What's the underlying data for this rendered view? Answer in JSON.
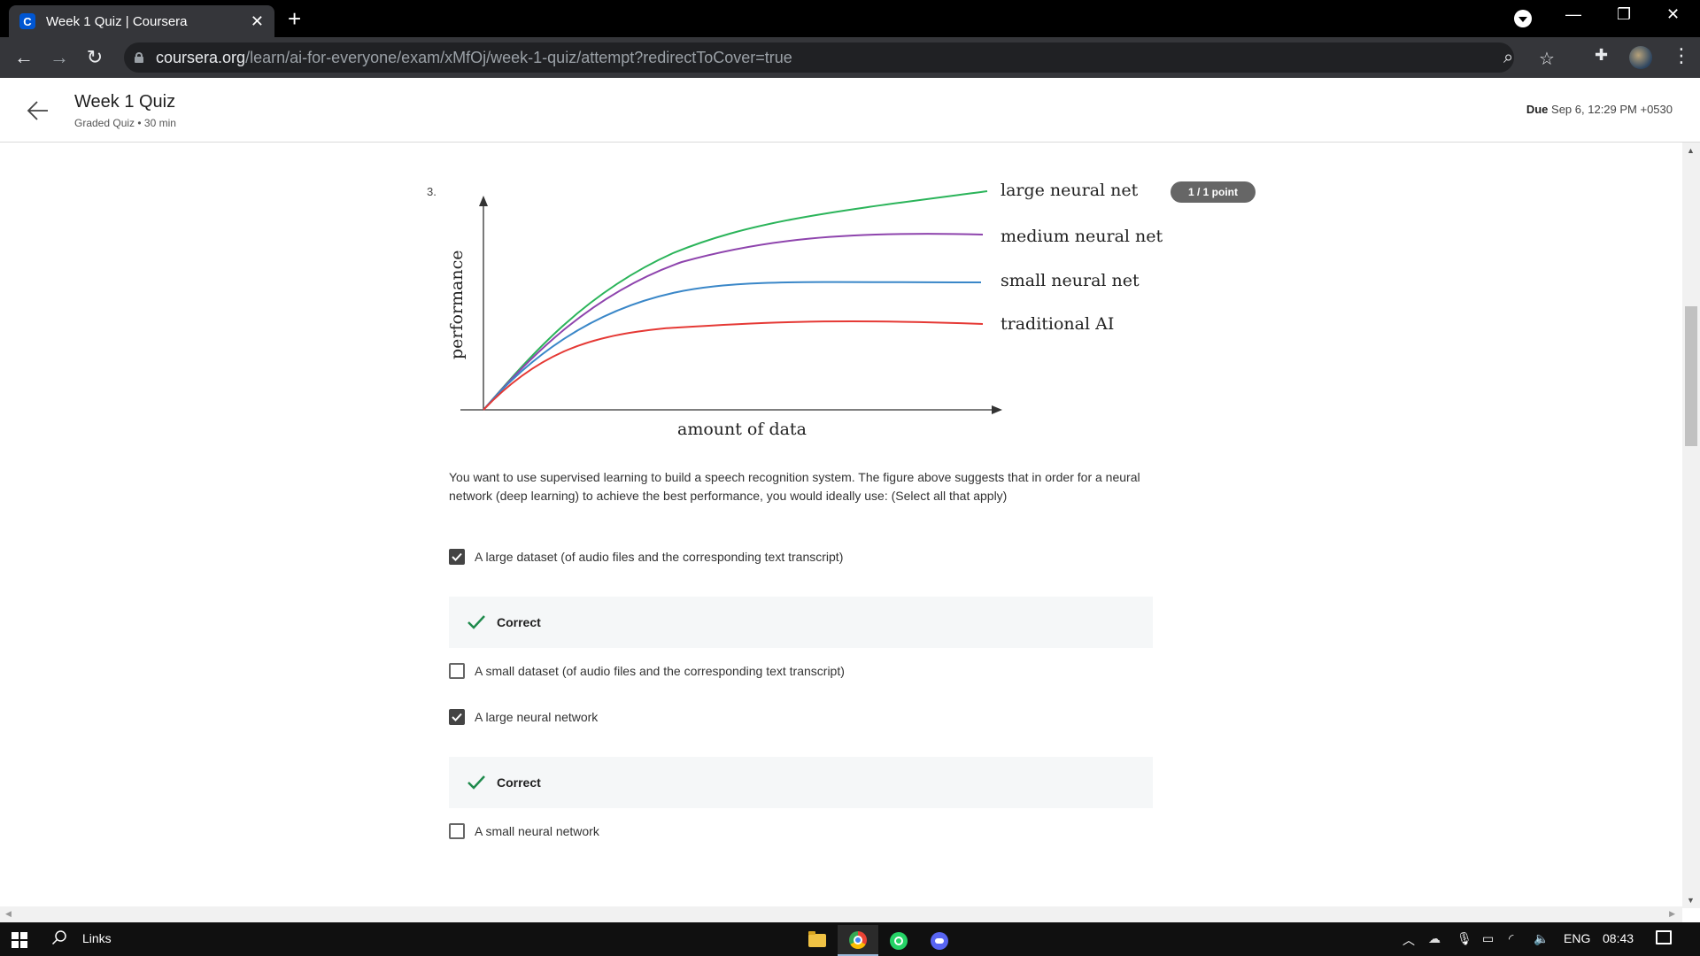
{
  "browser": {
    "tab_title": "Week 1 Quiz | Coursera",
    "tab_favicon": "C",
    "url_host": "coursera.org",
    "url_path": "/learn/ai-for-everyone/exam/xMfOj/week-1-quiz/attempt?redirectToCover=true"
  },
  "header": {
    "title": "Week 1 Quiz",
    "meta": "Graded Quiz • 30 min",
    "due_label": "Due",
    "due_value": "Sep 6, 12:29 PM +0530"
  },
  "question": {
    "number": "3.",
    "points": "1 / 1 point",
    "prompt": "You want to use supervised learning to build a speech recognition system. The figure above suggests that in order for a neural network (deep learning) to achieve the best performance, you would ideally use: (Select all that apply)",
    "options": [
      {
        "label": "A large dataset (of audio files and the corresponding text transcript)",
        "checked": true
      },
      {
        "label": "A small dataset (of audio files and the corresponding text transcript)",
        "checked": false
      },
      {
        "label": "A large neural network",
        "checked": true
      },
      {
        "label": "A small neural network",
        "checked": false
      }
    ],
    "feedback": [
      "Correct",
      "Correct"
    ]
  },
  "chart_data": {
    "type": "line",
    "xlabel": "amount of data",
    "ylabel": "performance",
    "series": [
      {
        "name": "large neural net",
        "color": "#2bb45a"
      },
      {
        "name": "medium neural net",
        "color": "#8e44ad"
      },
      {
        "name": "small neural net",
        "color": "#3a87c8"
      },
      {
        "name": "traditional AI",
        "color": "#e53935"
      }
    ]
  },
  "taskbar": {
    "search_label": "Links",
    "language": "ENG",
    "time": "08:43"
  },
  "colors": {
    "chrome_dark": "#35363a",
    "feedback_bg": "#f5f7f8",
    "check_green": "#1e8a4c"
  }
}
